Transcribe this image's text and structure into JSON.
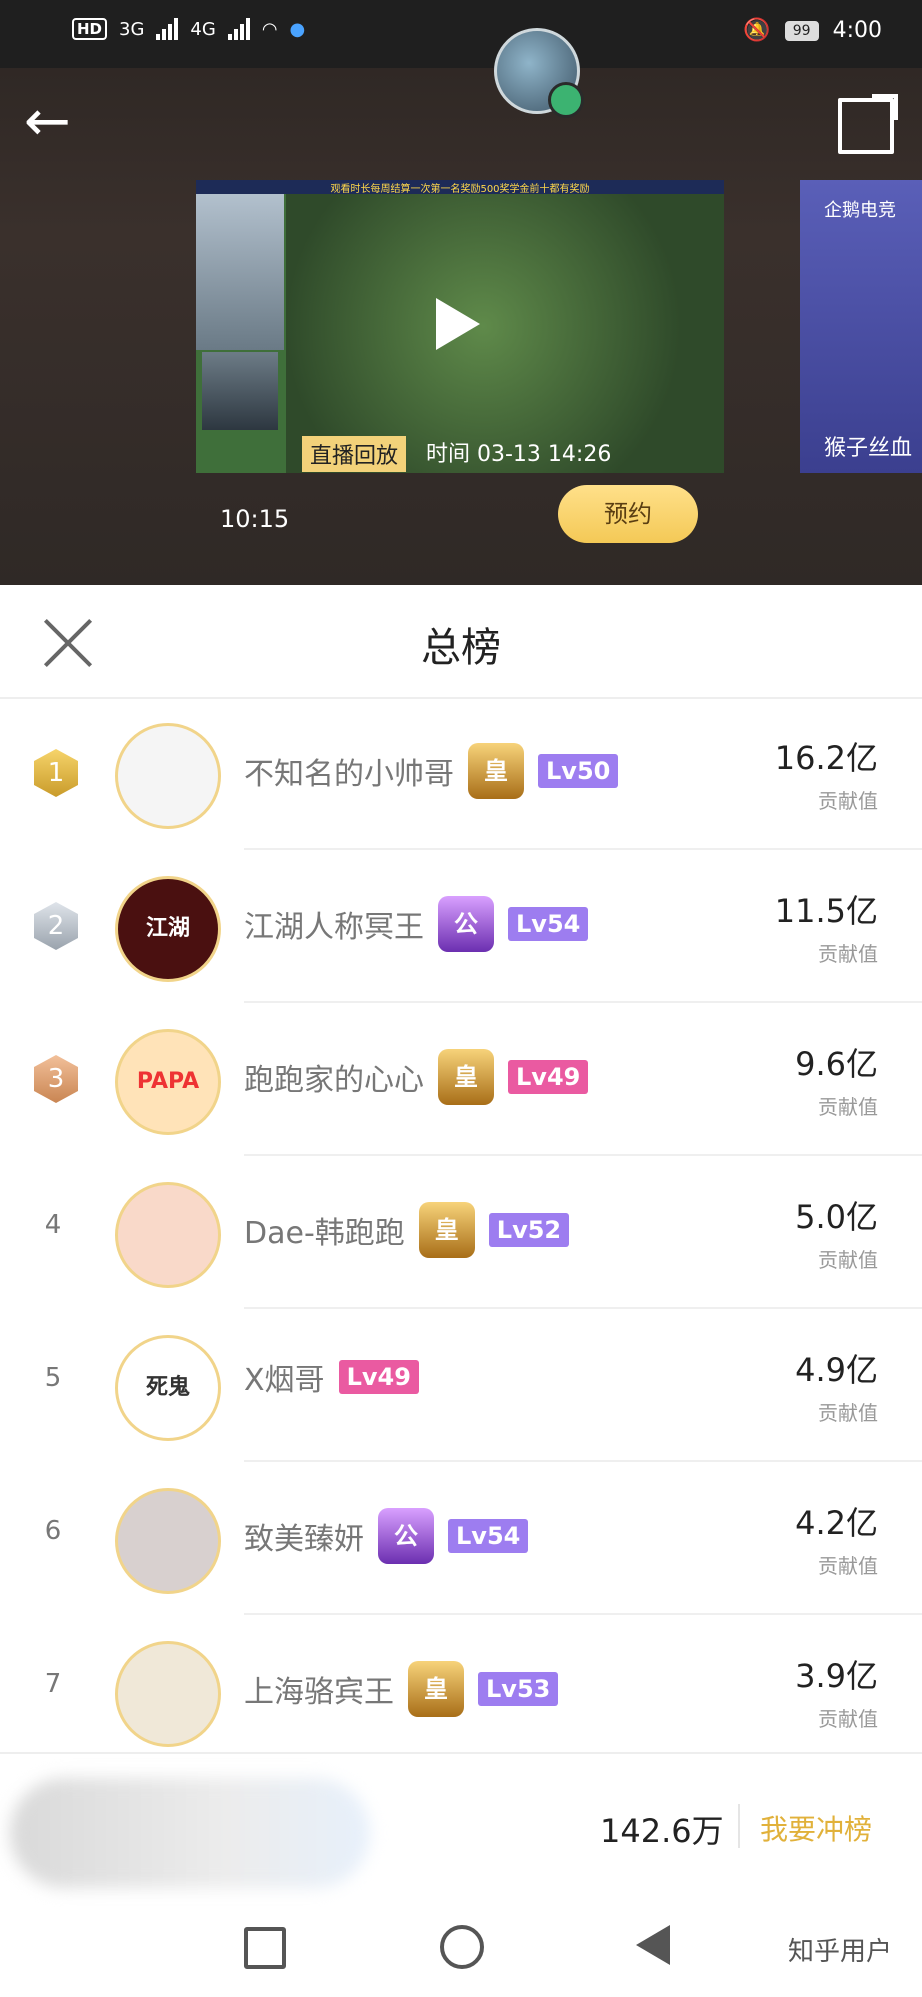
{
  "status_bar": {
    "hd": "HD",
    "net1": "3G",
    "net2": "4G",
    "battery": "99",
    "time": "4:00"
  },
  "video": {
    "banner": "观看时长每周结算一次第一名奖励500奖学金前十都有奖励",
    "replay_tag": "直播回放",
    "replay_time": "时间 03-13 14:26",
    "duration": "10:15",
    "reserve_label": "预约"
  },
  "side_card": {
    "brand": "企鹅电竞",
    "title": "猴子丝血"
  },
  "panel": {
    "title": "总榜",
    "rows": [
      {
        "rank": "1",
        "name": "不知名的小帅哥",
        "crest": "皇",
        "crest_style": "gold",
        "level": "Lv50",
        "level_color": "#9d7df0",
        "score": "16.2亿",
        "contrib": "贡献值",
        "avatar_text": ""
      },
      {
        "rank": "2",
        "name": "江湖人称冥王",
        "crest": "公",
        "crest_style": "purple",
        "level": "Lv54",
        "level_color": "#9d7df0",
        "score": "11.5亿",
        "contrib": "贡献值",
        "avatar_text": "江湖"
      },
      {
        "rank": "3",
        "name": "跑跑家的心心",
        "crest": "皇",
        "crest_style": "gold",
        "level": "Lv49",
        "level_color": "#ea5aa1",
        "score": "9.6亿",
        "contrib": "贡献值",
        "avatar_text": "PAPA"
      },
      {
        "rank": "4",
        "name": "Dae-韩跑跑",
        "crest": "皇",
        "crest_style": "gold",
        "level": "Lv52",
        "level_color": "#9d7df0",
        "score": "5.0亿",
        "contrib": "贡献值",
        "avatar_text": ""
      },
      {
        "rank": "5",
        "name": "X烟哥",
        "crest": "",
        "crest_style": "",
        "level": "Lv49",
        "level_color": "#ea5aa1",
        "score": "4.9亿",
        "contrib": "贡献值",
        "avatar_text": "死鬼"
      },
      {
        "rank": "6",
        "name": "致美臻妍",
        "crest": "公",
        "crest_style": "purple",
        "level": "Lv54",
        "level_color": "#9d7df0",
        "score": "4.2亿",
        "contrib": "贡献值",
        "avatar_text": ""
      },
      {
        "rank": "7",
        "name": "上海骆宾王",
        "crest": "皇",
        "crest_style": "gold",
        "level": "Lv53",
        "level_color": "#9d7df0",
        "score": "3.9亿",
        "contrib": "贡献值",
        "avatar_text": ""
      }
    ]
  },
  "bottom": {
    "my_score": "142.6万",
    "charge_label": "我要冲榜"
  },
  "watermark": "知乎用户"
}
